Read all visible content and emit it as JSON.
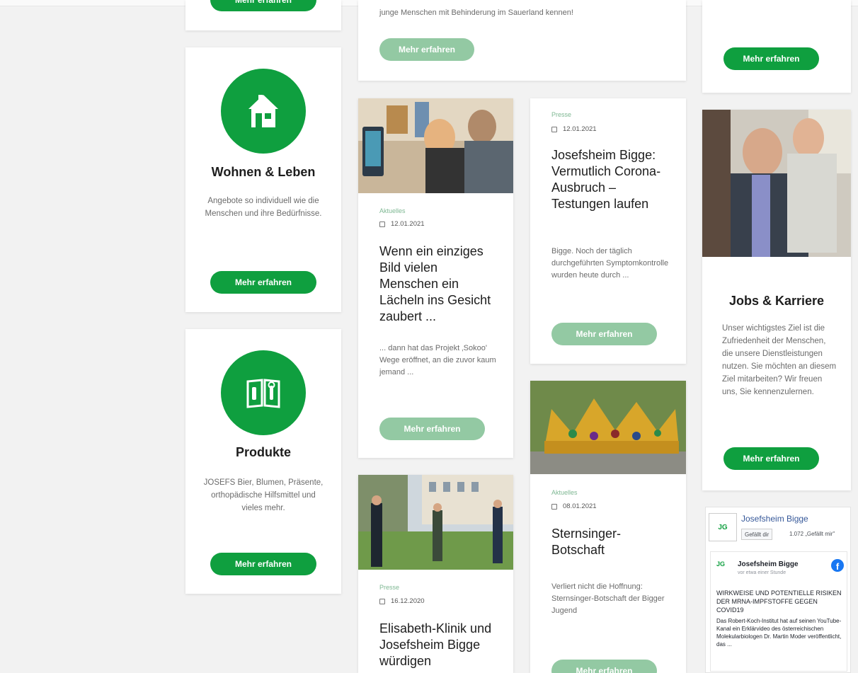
{
  "colors": {
    "brand_green": "#0f9f3f",
    "faded_green": "#93c9a3",
    "category_green": "#7fb893"
  },
  "cta_label": "Mehr erfahren",
  "top_center_text": "junge Menschen mit Behinderung im Sauerland kennen!",
  "features": {
    "wohnen": {
      "icon": "house-icon",
      "title": "Wohnen & Leben",
      "desc": "Angebote so individuell wie die Menschen und ihre Bedürfnisse."
    },
    "produkte": {
      "icon": "book-icon",
      "title": "Produkte",
      "desc": "JOSEFS Bier, Blumen, Präsente, orthopädische Hilfsmittel und vieles mehr."
    },
    "jobs": {
      "title": "Jobs & Karriere",
      "desc": "Unser wichtigstes Ziel ist die Zufriedenheit der Menschen, die unsere Dienstleistungen nutzen. Sie möchten an diesem Ziel mitarbeiten? Wir freuen uns, Sie kennenzulernen."
    }
  },
  "posts": {
    "lächeln": {
      "category": "Aktuelles",
      "date": "12.01.2021",
      "title": "Wenn ein einziges Bild vielen Menschen ein Lächeln ins Gesicht zaubert ...",
      "excerpt": "... dann hat das Projekt ‚Sokoo' Wege eröffnet, an die zuvor kaum jemand ..."
    },
    "corona": {
      "category": "Presse",
      "date": "12.01.2021",
      "title": "Josefsheim Bigge: Vermutlich Corona-Ausbruch – Testungen laufen",
      "excerpt": "Bigge. Noch der täglich durchgeführten Symptomkontrolle wurden heute durch ..."
    },
    "sternsinger": {
      "category": "Aktuelles",
      "date": "08.01.2021",
      "title": "Sternsinger-Botschaft",
      "excerpt": "Verliert nicht die Hoffnung: Sternsinger-Botschaft der Bigger Jugend"
    },
    "elisabeth": {
      "category": "Presse",
      "date": "16.12.2020",
      "title": "Elisabeth-Klinik und Josefsheim Bigge würdigen"
    }
  },
  "facebook": {
    "page_name": "Josefsheim Bigge",
    "like_label": "Gefällt dir",
    "like_count": "1.072 „Gefällt mir\"",
    "post_author": "Josefsheim Bigge",
    "post_time": "vor etwa einer Stunde",
    "post_headline": "WIRKWEISE UND POTENTIELLE RISIKEN DER MRNA-IMPFSTOFFE GEGEN COVID19",
    "post_body": "Das Robert-Koch-Institut hat auf seinen YouTube-Kanal ein Erklärvideo des österreichischen Molekularbiologen Dr. Martin Moder veröffentlicht, das ..."
  }
}
